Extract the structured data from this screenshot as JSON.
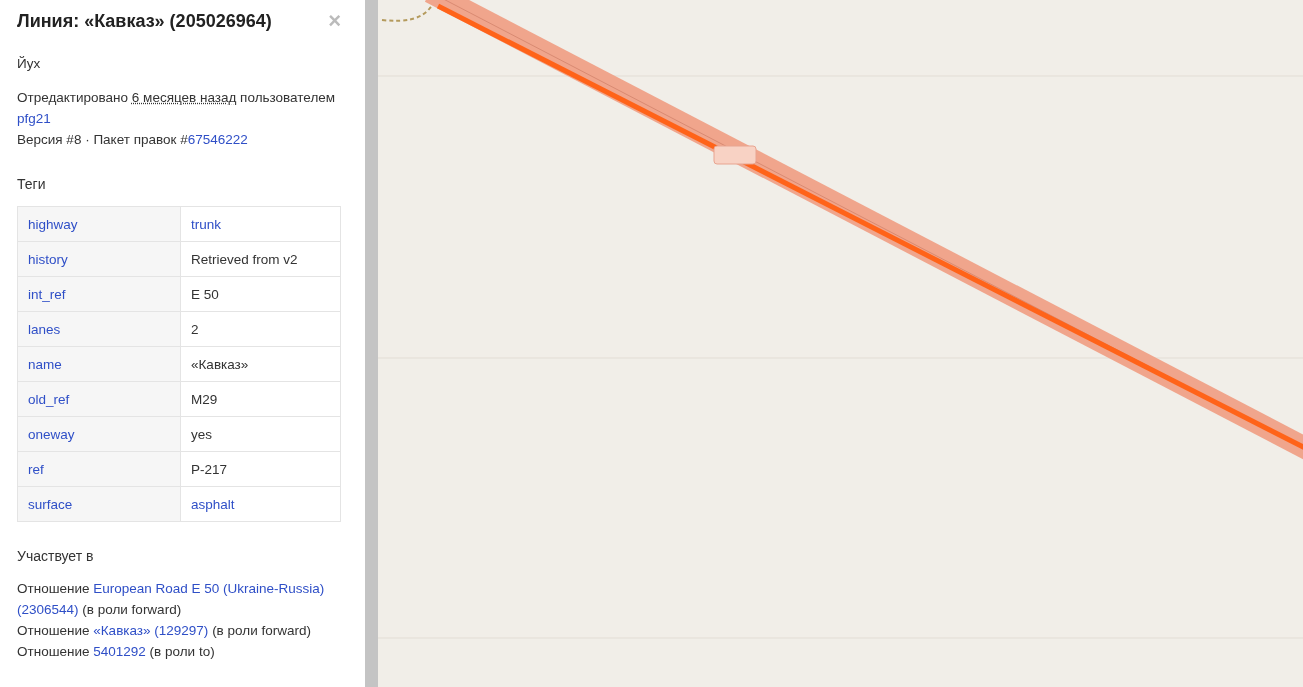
{
  "sidebar": {
    "title": "Линия: «Кавказ» (205026964)",
    "close": "×",
    "comment": "Йух",
    "edited": {
      "prefix": "Отредактировано",
      "time": "6 месяцев назад",
      "suffix": "пользователем",
      "user": "pfg21"
    },
    "version": {
      "text": "Версия #8 · Пакет правок #",
      "changeset": "67546222"
    },
    "tags_heading": "Теги",
    "tags": [
      {
        "key": "highway",
        "value": "trunk",
        "value_link": true
      },
      {
        "key": "history",
        "value": "Retrieved from v2",
        "value_link": false
      },
      {
        "key": "int_ref",
        "value": "E 50",
        "value_link": false
      },
      {
        "key": "lanes",
        "value": "2",
        "value_link": false
      },
      {
        "key": "name",
        "value": "«Кавказ»",
        "value_link": false
      },
      {
        "key": "old_ref",
        "value": "M29",
        "value_link": false
      },
      {
        "key": "oneway",
        "value": "yes",
        "value_link": false
      },
      {
        "key": "ref",
        "value": "P-217",
        "value_link": false
      },
      {
        "key": "surface",
        "value": "asphalt",
        "value_link": true
      }
    ],
    "membership_heading": "Участвует в",
    "memberships": [
      {
        "prefix": "Отношение",
        "relation": "European Road E 50 (Ukraine-Russia)",
        "relation_id": "(2306544)",
        "role": "(в роли forward)"
      },
      {
        "prefix": "Отношение",
        "relation": "«Кавказ»",
        "relation_id": "(129297)",
        "role": "(в роли forward)"
      },
      {
        "prefix": "Отношение",
        "relation": "5401292",
        "role": "(в роли to)"
      }
    ]
  }
}
